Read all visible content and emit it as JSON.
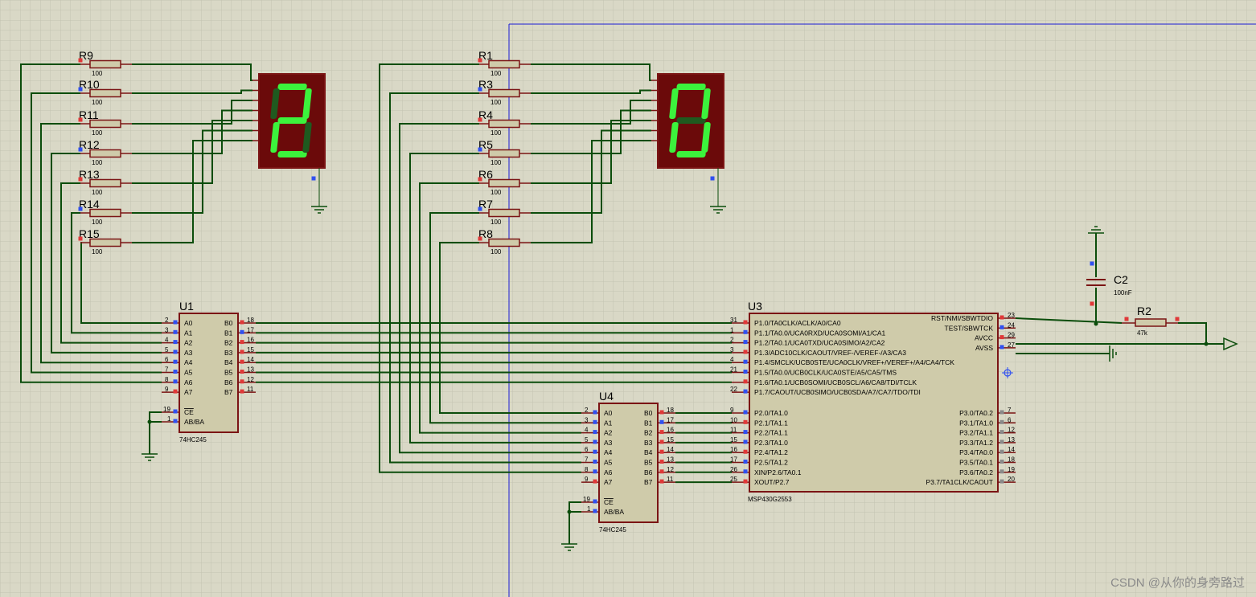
{
  "schematic": {
    "watermark": "CSDN @从你的身旁路过",
    "components": {
      "left_resistors": [
        {
          "ref": "R9",
          "value": "100"
        },
        {
          "ref": "R10",
          "value": "100"
        },
        {
          "ref": "R11",
          "value": "100"
        },
        {
          "ref": "R12",
          "value": "100"
        },
        {
          "ref": "R13",
          "value": "100"
        },
        {
          "ref": "R14",
          "value": "100"
        },
        {
          "ref": "R15",
          "value": "100"
        }
      ],
      "right_resistors": [
        {
          "ref": "R1",
          "value": "100"
        },
        {
          "ref": "R3",
          "value": "100"
        },
        {
          "ref": "R4",
          "value": "100"
        },
        {
          "ref": "R5",
          "value": "100"
        },
        {
          "ref": "R6",
          "value": "100"
        },
        {
          "ref": "R7",
          "value": "100"
        },
        {
          "ref": "R8",
          "value": "100"
        }
      ],
      "display_left": {
        "digit": "2"
      },
      "display_right": {
        "digit": "0"
      },
      "u1": {
        "ref": "U1",
        "part": "74HC245"
      },
      "u4": {
        "ref": "U4",
        "part": "74HC245"
      },
      "u3": {
        "ref": "U3",
        "part": "MSP430G2553"
      },
      "c2": {
        "ref": "C2",
        "value": "100nF"
      },
      "r2": {
        "ref": "R2",
        "value": "47k"
      }
    },
    "buffer_pins": {
      "a_names": [
        "A0",
        "A1",
        "A2",
        "A3",
        "A4",
        "A5",
        "A6",
        "A7"
      ],
      "b_names": [
        "B0",
        "B1",
        "B2",
        "B3",
        "B4",
        "B5",
        "B6",
        "B7"
      ],
      "a_nums": [
        "2",
        "3",
        "4",
        "5",
        "6",
        "7",
        "8",
        "9"
      ],
      "b_nums": [
        "18",
        "17",
        "16",
        "15",
        "14",
        "13",
        "12",
        "11"
      ],
      "ce": "CE",
      "dir": "AB/BA",
      "ce_num": "19",
      "dir_num": "1"
    },
    "mcu_pins": {
      "left": [
        {
          "num": "31",
          "name": "P1.0/TA0CLK/ACLK/A0/CA0"
        },
        {
          "num": "1",
          "name": "P1.1/TA0.0/UCA0RXD/UCA0SOMI/A1/CA1"
        },
        {
          "num": "2",
          "name": "P1.2/TA0.1/UCA0TXD/UCA0SIMO/A2/CA2"
        },
        {
          "num": "3",
          "name": "P1.3/ADC10CLK/CAOUT/VREF-/VEREF-/A3/CA3"
        },
        {
          "num": "4",
          "name": "P1.4/SMCLK/UCB0STE/UCA0CLK/VREF+/VEREF+/A4/CA4/TCK"
        },
        {
          "num": "21",
          "name": "P1.5/TA0.0/UCB0CLK/UCA0STE/A5/CA5/TMS"
        },
        {
          "num": "",
          "name": "P1.6/TA0.1/UCB0SOMI/UCB0SCL/A6/CA8/TDI/TCLK"
        },
        {
          "num": "22",
          "name": "P1.7/CAOUT/UCB0SIMO/UCB0SDA/A7/CA7/TDO/TDI"
        },
        {
          "num": "9",
          "name": "P2.0/TA1.0"
        },
        {
          "num": "10",
          "name": "P2.1/TA1.1"
        },
        {
          "num": "11",
          "name": "P2.2/TA1.1"
        },
        {
          "num": "15",
          "name": "P2.3/TA1.0"
        },
        {
          "num": "16",
          "name": "P2.4/TA1.2"
        },
        {
          "num": "17",
          "name": "P2.5/TA1.2"
        },
        {
          "num": "26",
          "name": "XIN/P2.6/TA0.1"
        },
        {
          "num": "25",
          "name": "XOUT/P2.7"
        }
      ],
      "right_top": [
        {
          "num": "23",
          "name": "RST/NMI/SBWTDIO"
        },
        {
          "num": "24",
          "name": "TEST/SBWTCK"
        },
        {
          "num": "29",
          "name": "AVCC"
        },
        {
          "num": "27",
          "name": "AVSS"
        }
      ],
      "right_bottom": [
        {
          "num": "7",
          "name": "P3.0/TA0.2"
        },
        {
          "num": "6",
          "name": "P3.1/TA1.0"
        },
        {
          "num": "12",
          "name": "P3.2/TA1.1"
        },
        {
          "num": "13",
          "name": "P3.3/TA1.2"
        },
        {
          "num": "14",
          "name": "P3.4/TA0.0"
        },
        {
          "num": "18",
          "name": "P3.5/TA0.1"
        },
        {
          "num": "19",
          "name": "P3.6/TA0.2"
        },
        {
          "num": "20",
          "name": "P3.7/TA1CLK/CAOUT"
        }
      ]
    },
    "colors": {
      "background": "#d9d8c6",
      "grid": "#c4c3b1",
      "wire": "#0b4d0b",
      "body_outline": "#7b1414",
      "body_fill": "#cfcbaa",
      "display_fill": "#6b0a0a",
      "segment_on": "#3cf23c",
      "segment_off": "#1f5a1f",
      "pin_red": "#e03838",
      "pin_blue": "#3050f0",
      "guide_line": "#1c1cd6"
    }
  }
}
